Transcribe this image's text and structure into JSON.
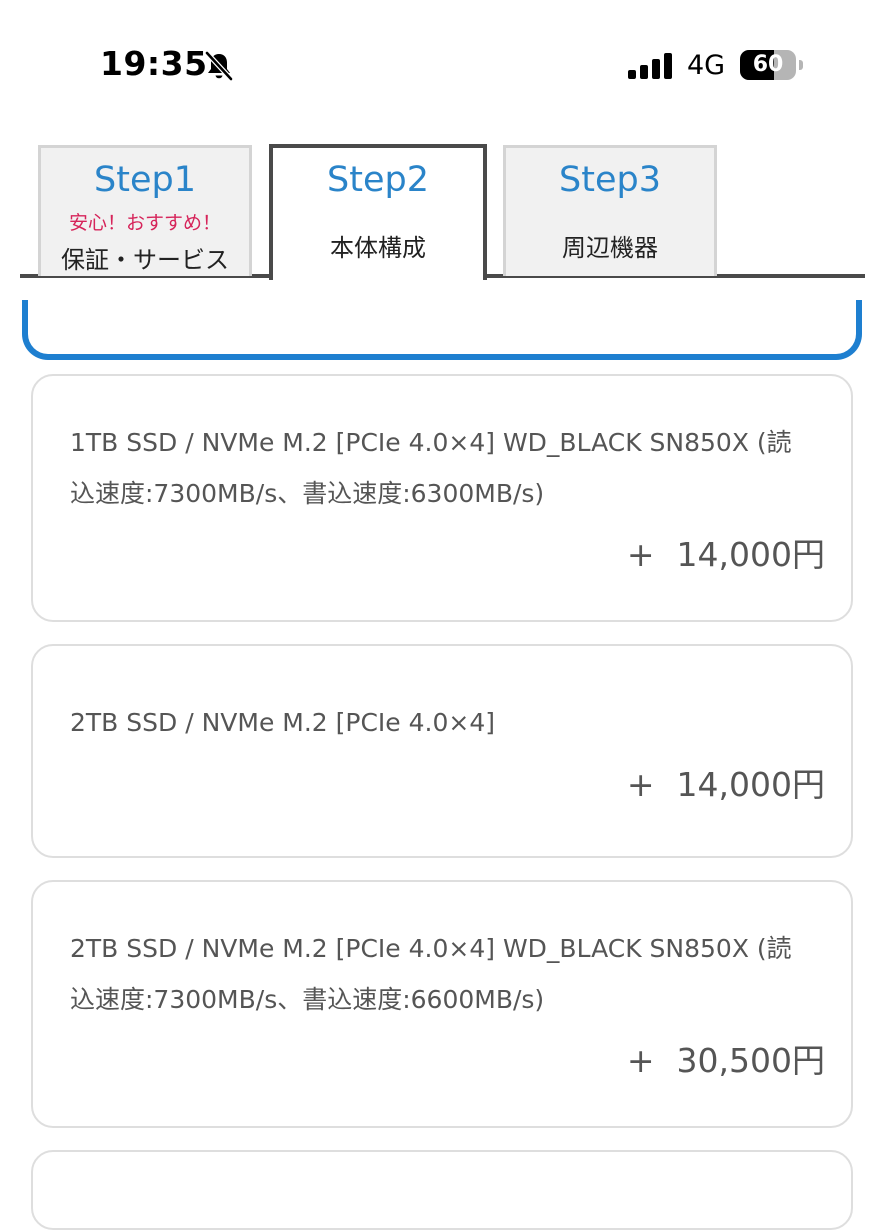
{
  "status_bar": {
    "time": "19:35",
    "network": "4G",
    "battery_level": "60",
    "battery_fraction": 0.6,
    "icons": [
      "bell-off-icon",
      "signal-icon",
      "battery-icon"
    ]
  },
  "tabs": [
    {
      "title": "Step1",
      "badge": "安心！おすすめ！",
      "label": "保証・サービス",
      "active": false
    },
    {
      "title": "Step2",
      "label": "本体構成",
      "active": true
    },
    {
      "title": "Step3",
      "label": "周辺機器",
      "active": false
    }
  ],
  "options": [
    {
      "name_line1": "1TB SSD / NVMe M.2 [PCIe 4.0×4] WD_BLACK SN850X (読",
      "name_line2": "込速度:7300MB/s、書込速度:6300MB/s)",
      "plus": "+",
      "price": "14,000円"
    },
    {
      "name_line1": "2TB SSD / NVMe M.2 [PCIe 4.0×4]",
      "plus": "+",
      "price": "14,000円"
    },
    {
      "name_line1": "2TB SSD / NVMe M.2 [PCIe 4.0×4] WD_BLACK SN850X (読",
      "name_line2": "込速度:7300MB/s、書込速度:6600MB/s)",
      "plus": "+",
      "price": "30,500円"
    }
  ],
  "colors": {
    "accent_blue": "#1e7fd0",
    "tab_title": "#2a84c9",
    "badge_pink": "#d6245a",
    "text_gray": "#555555",
    "card_border": "#dedede"
  }
}
